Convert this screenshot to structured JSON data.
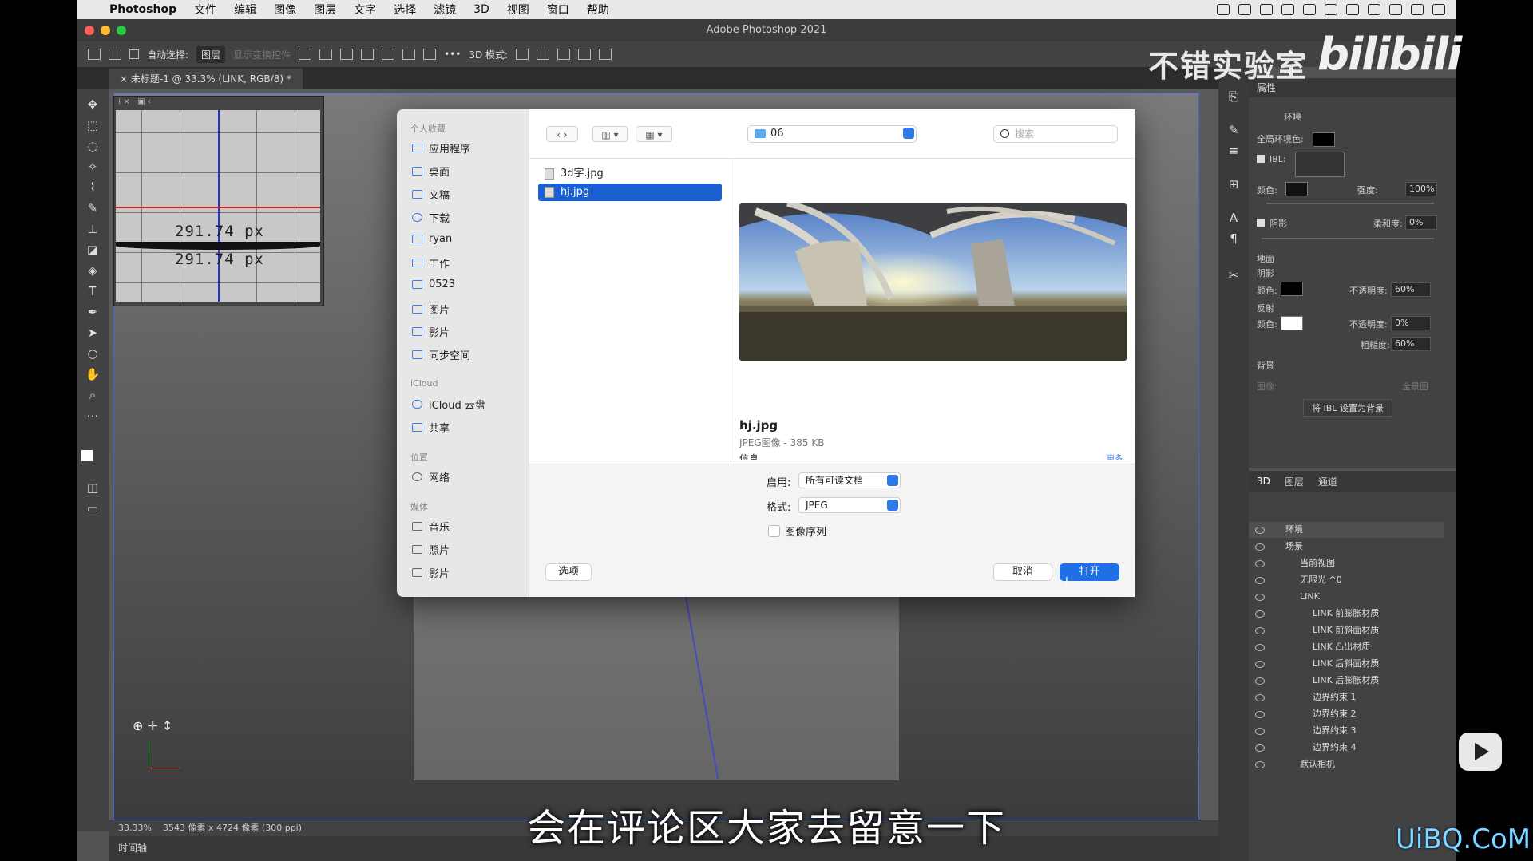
{
  "menubar": {
    "app": "Photoshop",
    "items": [
      "文件",
      "编辑",
      "图像",
      "图层",
      "文字",
      "选择",
      "滤镜",
      "3D",
      "视图",
      "窗口",
      "帮助"
    ]
  },
  "window": {
    "title": "Adobe Photoshop 2021"
  },
  "options_bar": {
    "auto_select_label": "自动选择:",
    "auto_select_value": "图层",
    "show_transform": "显示变换控件",
    "mode_label": "3D 模式:"
  },
  "document": {
    "tab": "未标题-1 @ 33.3% (LINK, RGB/8) *",
    "zoom": "33.33%",
    "size_info": "3543 像素 x 4724 像素 (300 ppi)",
    "timeline": "时间轴",
    "nav_text_1": "291.74 px",
    "nav_text_2": "291.74 px"
  },
  "properties": {
    "title": "属性",
    "tab": "环境",
    "global_ambient": "全局环境色:",
    "ibl": "IBL:",
    "color": "颜色:",
    "intensity_label": "强度:",
    "intensity": "100%",
    "shadow": "阴影",
    "softness_label": "柔和度:",
    "softness": "0%",
    "ground": "地面",
    "ground_shadow": "阴影",
    "ground_color": "颜色:",
    "opacity_label": "不透明度:",
    "opacity1": "60%",
    "reflection": "反射",
    "reflection_color": "颜色:",
    "opacity2": "0%",
    "roughness_label": "粗糙度:",
    "roughness": "60%",
    "background": "背景",
    "image_label": "图像:",
    "panorama": "全景图",
    "set_ibl_bg": "将 IBL 设置为背景"
  },
  "layers_panel": {
    "tabs": [
      "3D",
      "图层",
      "通道"
    ],
    "rows": [
      "环境",
      "场景",
      "当前视图",
      "无限光 ^0",
      "LINK",
      "LINK 前膨胀材质",
      "LINK 前斜面材质",
      "LINK 凸出材质",
      "LINK 后斜面材质",
      "LINK 后膨胀材质",
      "边界约束 1",
      "边界约束 2",
      "边界约束 3",
      "边界约束 4",
      "默认相机"
    ]
  },
  "dialog": {
    "sidebar": {
      "favorites_head": "个人收藏",
      "favorites": [
        "应用程序",
        "桌面",
        "文稿",
        "下载",
        "ryan",
        "工作",
        "0523",
        "图片",
        "影片",
        "同步空间"
      ],
      "icloud_head": "iCloud",
      "icloud": [
        "iCloud 云盘",
        "共享"
      ],
      "location_head": "位置",
      "locations": [
        "网络"
      ],
      "media_head": "媒体",
      "media": [
        "音乐",
        "照片",
        "影片"
      ]
    },
    "folder": "06",
    "search_placeholder": "搜索",
    "files": [
      "3d字.jpg",
      "hj.jpg"
    ],
    "preview_name": "hj.jpg",
    "preview_info": "JPEG图像 - 385 KB",
    "info_label": "信息",
    "more_label": "更多",
    "enable_label": "启用:",
    "enable_value": "所有可读文档",
    "format_label": "格式:",
    "format_value": "JPEG",
    "image_sequence": "图像序列",
    "options_btn": "选项",
    "cancel_btn": "取消",
    "open_btn": "打开"
  },
  "overlay": {
    "watermark": "不错实验室",
    "bili": "bilibili",
    "subtitle": "会在评论区大家去留意一下",
    "site": "UiBQ.CoM"
  },
  "colors": {
    "accent": "#1f6fe6",
    "ps_bg": "#535353"
  }
}
